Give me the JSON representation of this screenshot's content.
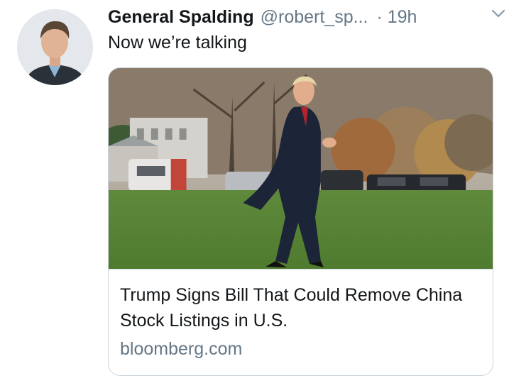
{
  "tweet": {
    "author_name": "General Spalding",
    "handle": "@robert_sp...",
    "time": "· 19h",
    "text": "Now we’re talking"
  },
  "card": {
    "title": "Trump Signs Bill That Could Remove China Stock Listings in U.S.",
    "domain": "bloomberg.com"
  },
  "icons": {
    "avatar": "profile-photo",
    "more": "chevron-down-icon"
  },
  "colors": {
    "text_primary": "#14171a",
    "text_secondary": "#657786",
    "border": "#ccd6dd"
  }
}
